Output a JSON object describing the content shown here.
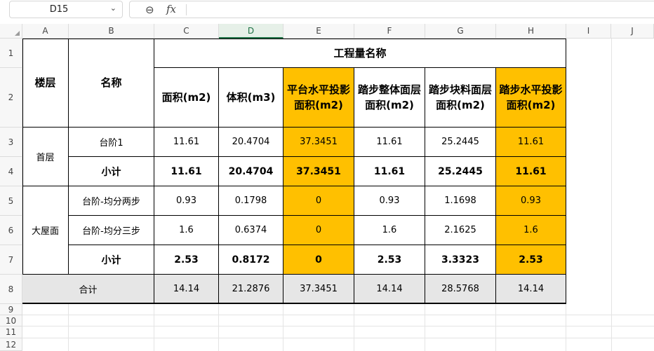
{
  "formula_bar": {
    "cell_ref": "D15",
    "fx_label": "fx"
  },
  "columns": [
    "A",
    "B",
    "C",
    "D",
    "E",
    "F",
    "G",
    "H",
    "I",
    "J"
  ],
  "rows": [
    "1",
    "2",
    "3",
    "4",
    "5",
    "6",
    "7",
    "8",
    "9",
    "10",
    "11",
    "12"
  ],
  "table": {
    "title": "工程量名称",
    "floor_header": "楼层",
    "name_header": "名称",
    "col_headers": [
      "面积(m2)",
      "体积(m3)",
      "平台水平投影面积(m2)",
      "踏步整体面层面积(m2)",
      "踏步块料面层面积(m2)",
      "踏步水平投影面积(m2)"
    ],
    "groups": [
      {
        "floor": "首层",
        "rows": [
          {
            "name": "台阶1",
            "values": [
              "11.61",
              "20.4704",
              "37.3451",
              "11.61",
              "25.2445",
              "11.61"
            ]
          },
          {
            "name": "小计",
            "values": [
              "11.61",
              "20.4704",
              "37.3451",
              "11.61",
              "25.2445",
              "11.61"
            ]
          }
        ]
      },
      {
        "floor": "大屋面",
        "rows": [
          {
            "name": "台阶-均分两步",
            "values": [
              "0.93",
              "0.1798",
              "0",
              "0.93",
              "1.1698",
              "0.93"
            ]
          },
          {
            "name": "台阶-均分三步",
            "values": [
              "1.6",
              "0.6374",
              "0",
              "1.6",
              "2.1625",
              "1.6"
            ]
          },
          {
            "name": "小计",
            "values": [
              "2.53",
              "0.8172",
              "0",
              "2.53",
              "3.3323",
              "2.53"
            ]
          }
        ]
      }
    ],
    "total": {
      "label": "合计",
      "values": [
        "14.14",
        "21.2876",
        "37.3451",
        "14.14",
        "28.5768",
        "14.14"
      ]
    }
  },
  "colors": {
    "highlight": "#ffc000",
    "total_row": "#e6e6e6",
    "active_column": "#217346"
  },
  "icons": {
    "namebox_dropdown": "chevron-down-icon",
    "zoom": "zoom-out-icon"
  }
}
